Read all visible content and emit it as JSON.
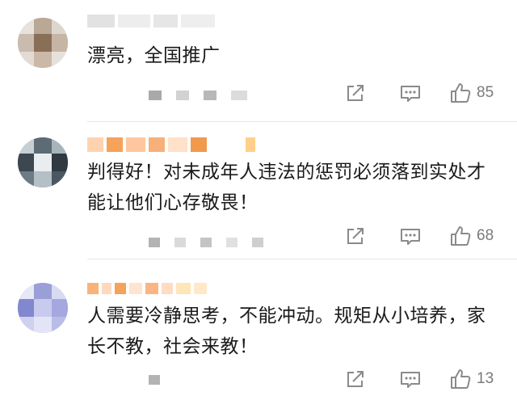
{
  "comments": [
    {
      "text": "漂亮，全国推广",
      "likes": "85",
      "actions": {
        "share_icon": "share-square-arrow-icon",
        "reply_icon": "comment-icon",
        "like_icon": "thumbs-up-icon"
      }
    },
    {
      "text": "判得好！对未成年人违法的惩罚必须落到实处才能让他们心存敬畏！",
      "likes": "68",
      "actions": {
        "share_icon": "share-square-arrow-icon",
        "reply_icon": "comment-icon",
        "like_icon": "thumbs-up-icon"
      }
    },
    {
      "text": "人需要冷静思考，不能冲动。规矩从小培养，家长不教，社会来教！",
      "likes": "13",
      "actions": {
        "share_icon": "share-square-arrow-icon",
        "reply_icon": "comment-icon",
        "like_icon": "thumbs-up-icon"
      }
    }
  ],
  "colors": {
    "text": "#1a1a1a",
    "meta": "#7a7a7a",
    "divider": "#e6e6e6",
    "username_orange": "#f5a25a"
  }
}
